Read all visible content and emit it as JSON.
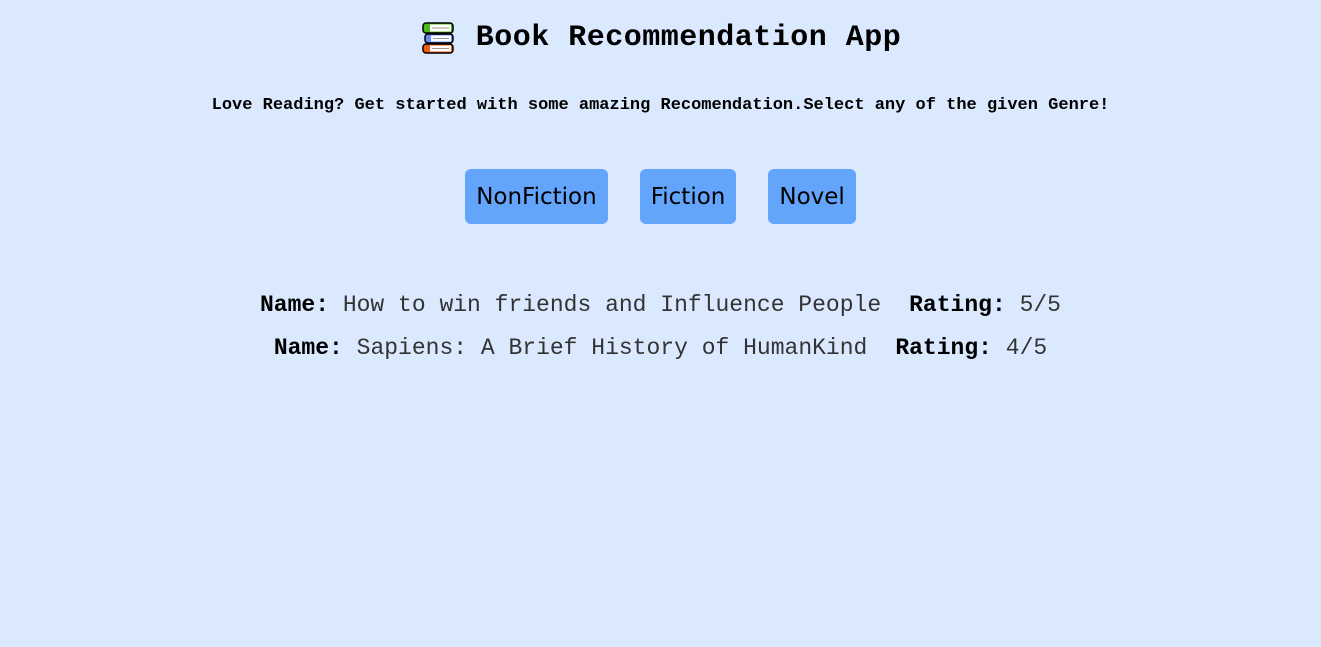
{
  "header": {
    "title": "Book Recommendation App",
    "icon": "books-icon"
  },
  "subtitle": "Love Reading? Get started with some amazing Recomendation.Select any of the given Genre!",
  "genres": [
    "NonFiction",
    "Fiction",
    "Novel"
  ],
  "books": [
    {
      "name_label": "Name:",
      "name": "How to win friends and Influence People",
      "rating_label": "Rating:",
      "rating": "5/5"
    },
    {
      "name_label": "Name:",
      "name": "Sapiens: A Brief History of HumanKind",
      "rating_label": "Rating:",
      "rating": "4/5"
    }
  ],
  "colors": {
    "background": "#dbe9ff",
    "button": "#62a5fa"
  }
}
